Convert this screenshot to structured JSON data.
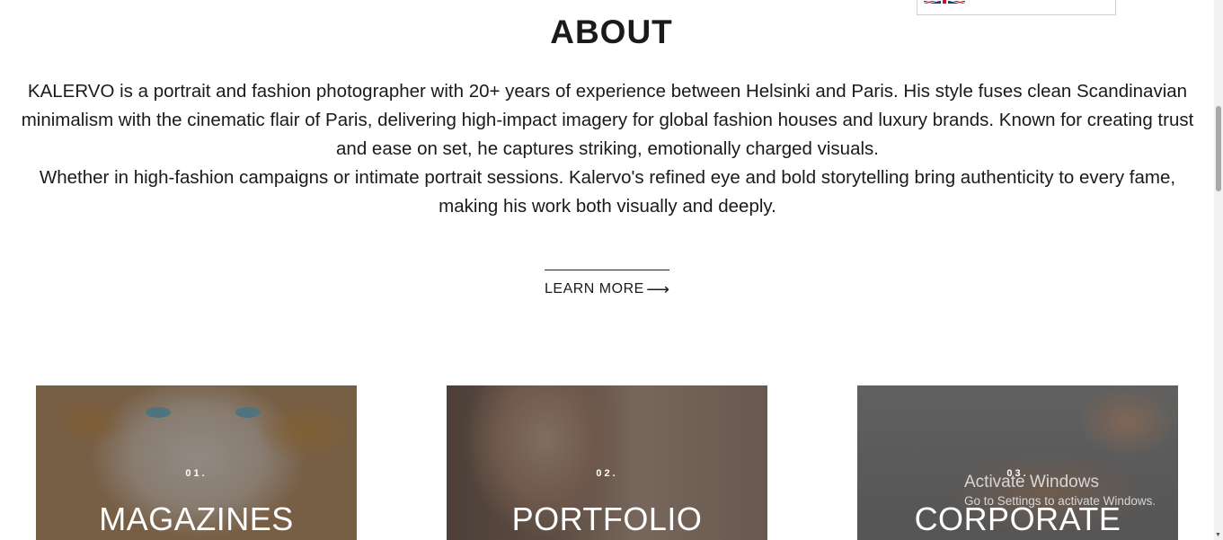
{
  "language": {
    "icon": "uk-flag-icon"
  },
  "about": {
    "title": "ABOUT",
    "paragraph1": "KALERVO is a portrait and fashion photographer with 20+ years of experience between Helsinki and Paris. His style fuses clean Scandinavian minimalism with the cinematic flair of Paris, delivering high-impact imagery for global fashion houses and luxury brands. Known for creating trust and ease on set, he captures striking, emotionally charged visuals.",
    "paragraph2": "Whether in high-fashion campaigns or intimate portrait sessions. Kalervo's refined eye and bold storytelling bring authenticity to every fame, making his work both visually and deeply.",
    "cta_label": "LEARN MORE",
    "cta_icon": "arrow-right-icon"
  },
  "categories": [
    {
      "number": "01.",
      "label": "MAGAZINES"
    },
    {
      "number": "02.",
      "label": "PORTFOLIO"
    },
    {
      "number": "03.",
      "label": "CORPORATE"
    }
  ],
  "watermark": {
    "title": "Activate Windows",
    "subtitle": "Go to Settings to activate Windows."
  }
}
